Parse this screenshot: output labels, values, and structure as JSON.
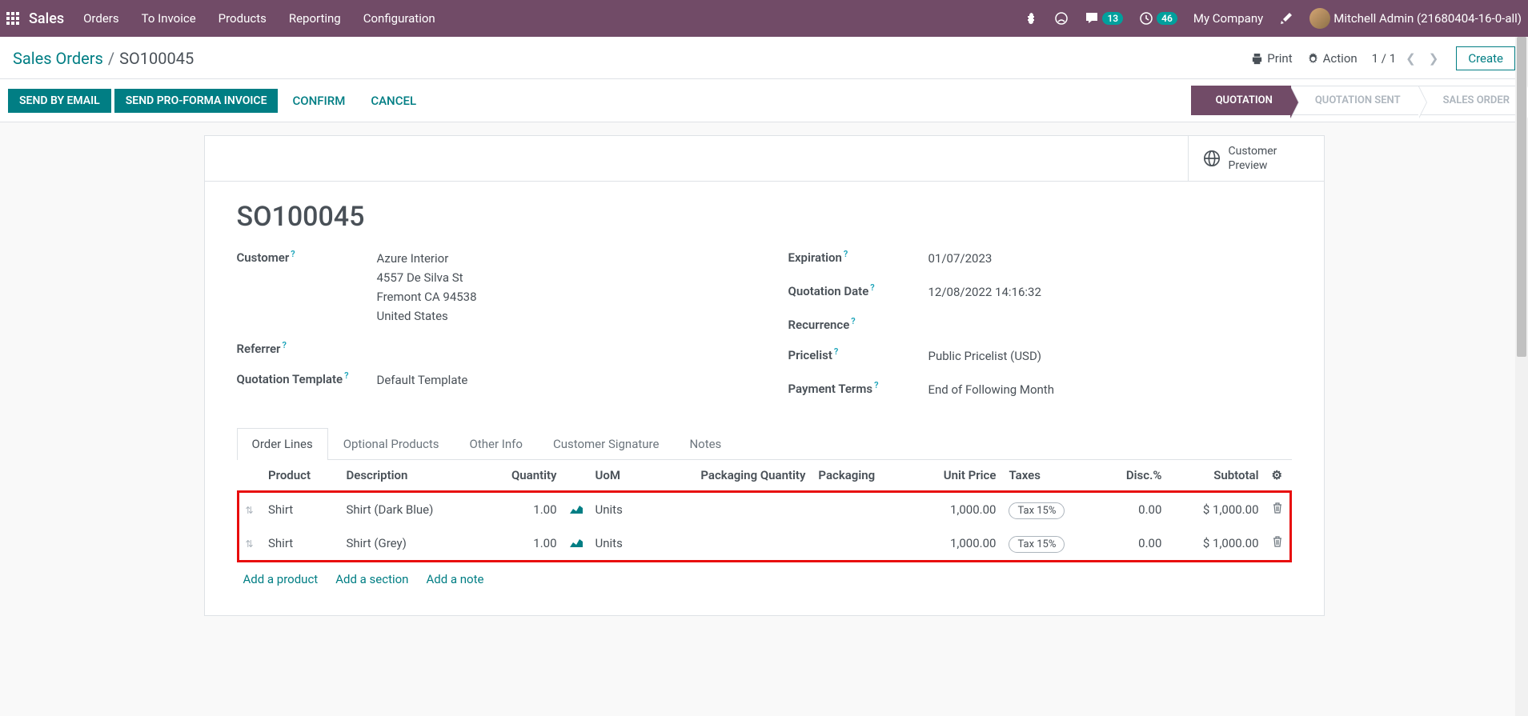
{
  "topbar": {
    "brand": "Sales",
    "menu": [
      "Orders",
      "To Invoice",
      "Products",
      "Reporting",
      "Configuration"
    ],
    "badge_msg": "13",
    "badge_activity": "46",
    "company": "My Company",
    "user": "Mitchell Admin (21680404-16-0-all)"
  },
  "breadcrumb": {
    "parent": "Sales Orders",
    "current": "SO100045"
  },
  "cp": {
    "print": "Print",
    "action": "Action",
    "pager": "1 / 1",
    "create": "Create"
  },
  "buttons": {
    "send_email": "SEND BY EMAIL",
    "send_proforma": "SEND PRO-FORMA INVOICE",
    "confirm": "CONFIRM",
    "cancel": "CANCEL"
  },
  "status": [
    "QUOTATION",
    "QUOTATION SENT",
    "SALES ORDER"
  ],
  "stat_button": "Customer\nPreview",
  "stat_button_l1": "Customer",
  "stat_button_l2": "Preview",
  "record": {
    "name": "SO100045",
    "labels": {
      "customer": "Customer",
      "referrer": "Referrer",
      "quotation_template": "Quotation Template",
      "expiration": "Expiration",
      "quotation_date": "Quotation Date",
      "recurrence": "Recurrence",
      "pricelist": "Pricelist",
      "payment_terms": "Payment Terms"
    },
    "customer_name": "Azure Interior",
    "customer_addr1": "4557 De Silva St",
    "customer_addr2": "Fremont CA 94538",
    "customer_country": "United States",
    "quotation_template": "Default Template",
    "expiration": "01/07/2023",
    "quotation_date": "12/08/2022 14:16:32",
    "pricelist": "Public Pricelist (USD)",
    "payment_terms": "End of Following Month"
  },
  "tabs": [
    "Order Lines",
    "Optional Products",
    "Other Info",
    "Customer Signature",
    "Notes"
  ],
  "columns": {
    "product": "Product",
    "description": "Description",
    "quantity": "Quantity",
    "uom": "UoM",
    "pack_qty": "Packaging Quantity",
    "packaging": "Packaging",
    "unit_price": "Unit Price",
    "taxes": "Taxes",
    "disc": "Disc.%",
    "subtotal": "Subtotal"
  },
  "lines": [
    {
      "product": "Shirt",
      "description": "Shirt (Dark Blue)",
      "qty": "1.00",
      "uom": "Units",
      "price": "1,000.00",
      "tax": "Tax 15%",
      "disc": "0.00",
      "subtotal": "$ 1,000.00"
    },
    {
      "product": "Shirt",
      "description": "Shirt (Grey)",
      "qty": "1.00",
      "uom": "Units",
      "price": "1,000.00",
      "tax": "Tax 15%",
      "disc": "0.00",
      "subtotal": "$ 1,000.00"
    }
  ],
  "add_links": {
    "product": "Add a product",
    "section": "Add a section",
    "note": "Add a note"
  }
}
